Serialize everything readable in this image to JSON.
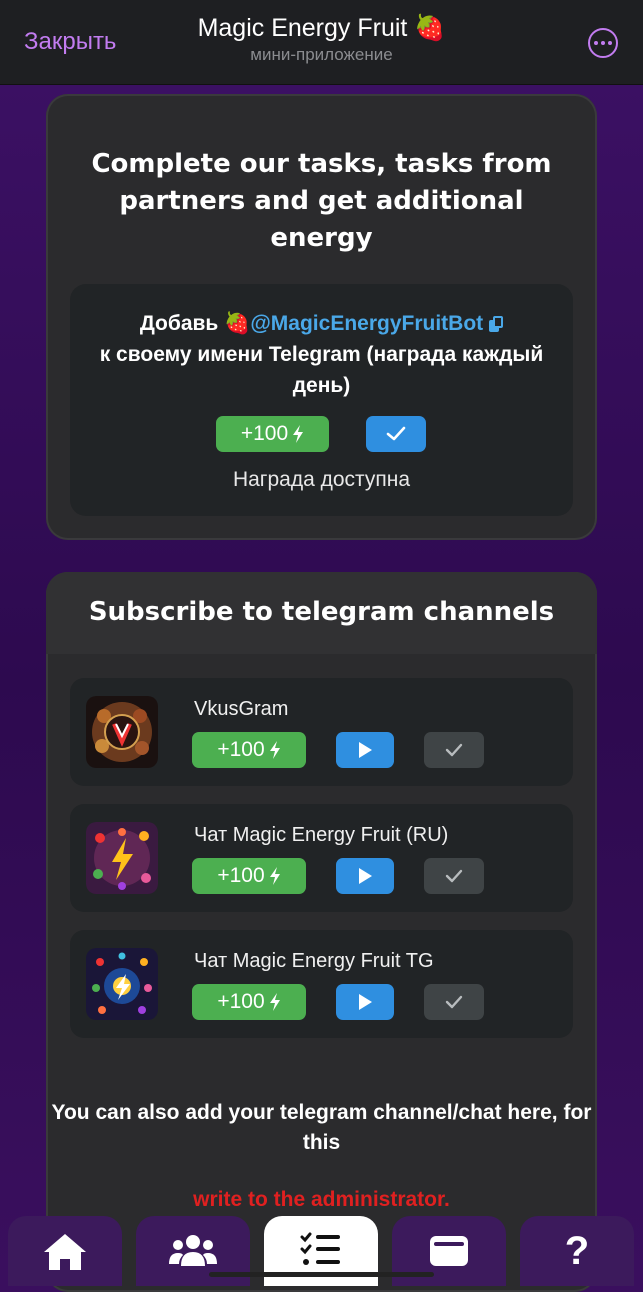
{
  "topbar": {
    "close_label": "Закрыть",
    "title": "Magic Energy Fruit 🍓",
    "subtitle": "мини-приложение"
  },
  "tasks_card": {
    "title": "Complete our tasks, tasks from partners and get additional energy",
    "task": {
      "prefix": "Добавь 🍓",
      "mention": "@MagicEnergyFruitBot",
      "suffix": "к своему имени Telegram (награда каждый день)",
      "reward": "+100",
      "status": "Награда доступна"
    }
  },
  "channels_card": {
    "title": "Subscribe to telegram channels",
    "channels": [
      {
        "name": "VkusGram",
        "reward": "+100"
      },
      {
        "name": "Чат Magic Energy Fruit (RU)",
        "reward": "+100"
      },
      {
        "name": "Чат Magic Energy Fruit TG",
        "reward": "+100"
      }
    ],
    "footer": "You can also add your telegram channel/chat here, for this",
    "admin_link": "write to the administrator."
  },
  "bottom_nav": {
    "items": [
      "home",
      "friends",
      "tasks",
      "wallet",
      "help"
    ],
    "active": "tasks",
    "help_label": "?"
  },
  "colors": {
    "accent": "#c27cf0",
    "reward_green": "#4caf50",
    "action_blue": "#2f8fe0",
    "link_blue": "#4aa8e8",
    "admin_red": "#e02020"
  }
}
